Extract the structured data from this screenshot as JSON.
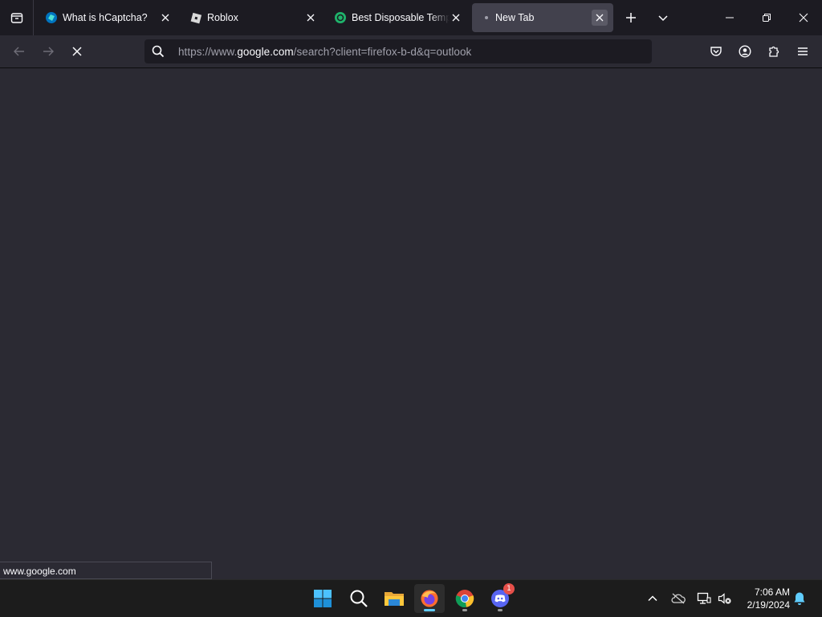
{
  "browser": {
    "tabs": [
      {
        "title": "What is hCaptcha?",
        "icon": "hcaptcha-icon",
        "active": false
      },
      {
        "title": "Roblox",
        "icon": "roblox-icon",
        "active": false
      },
      {
        "title": "Best Disposable Temporary Email",
        "icon": "temp-mail-icon",
        "active": false
      },
      {
        "title": "New Tab",
        "icon": "loading-dot-icon",
        "active": true
      }
    ],
    "url": {
      "scheme": "https://www.",
      "host": "google.com",
      "path": "/search?client=firefox-b-d&q=outlook"
    },
    "status_text": "www.google.com"
  },
  "taskbar": {
    "apps": [
      "windows-start-icon",
      "search-icon",
      "file-explorer-icon",
      "firefox-icon",
      "chrome-icon",
      "discord-icon"
    ],
    "discord_badge": "1",
    "clock": {
      "time": "7:06 AM",
      "date": "2/19/2024"
    }
  },
  "colors": {
    "chrome_bg": "#1c1b22",
    "toolbar_bg": "#2b2a33",
    "active_tab": "#42414d",
    "taskbar_bg": "#1c1c1c",
    "accent": "#60cdff"
  }
}
